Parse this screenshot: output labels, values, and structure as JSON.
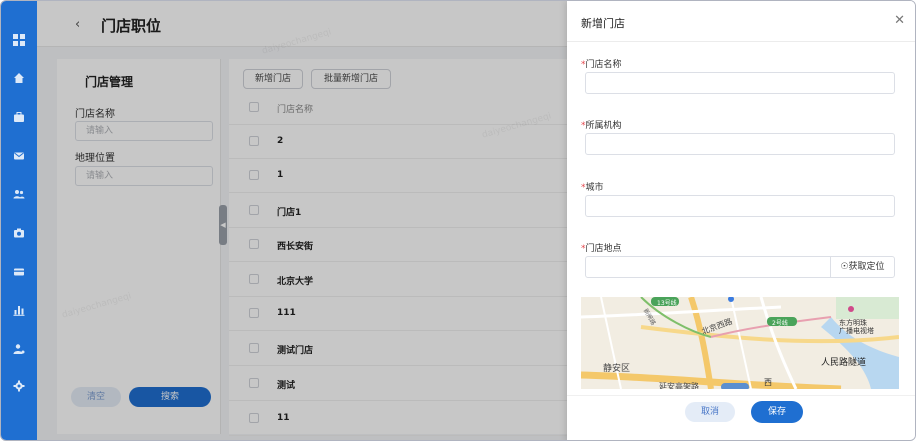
{
  "header": {
    "back_icon": "chevron-left-icon",
    "title": "门店职位"
  },
  "rail": {
    "icons": [
      "grid-icon",
      "home-icon",
      "briefcase-icon",
      "mail-icon",
      "users-icon",
      "camera-icon",
      "card-icon",
      "bar-chart-icon",
      "user-settings-icon",
      "gear-icon"
    ],
    "color": "#1f6fd1"
  },
  "filter": {
    "title": "门店管理",
    "fields": [
      {
        "label": "门店名称",
        "placeholder": "请输入"
      },
      {
        "label": "地理位置",
        "placeholder": "请输入"
      }
    ],
    "clear_label": "清空",
    "search_label": "搜索"
  },
  "toolbar": {
    "add_label": "新增门店",
    "batch_add_label": "批量新增门店"
  },
  "table": {
    "header": "门店名称",
    "rows": [
      "2",
      "1",
      "门店1",
      "西长安街",
      "北京大学",
      "111",
      "测试门店",
      "测试",
      "11"
    ]
  },
  "drawer": {
    "title": "新增门店",
    "close_icon": "close-icon",
    "fields": [
      {
        "label": "门店名称",
        "required_mark": "*"
      },
      {
        "label": "所属机构",
        "required_mark": "*"
      },
      {
        "label": "城市",
        "required_mark": "*"
      },
      {
        "label": "门店地点",
        "required_mark": "*"
      }
    ],
    "locate_label": "获取定位",
    "locate_icon": "location-pin-icon",
    "map_labels": {
      "beijing_west_road": "北京西路",
      "line2": "2号线",
      "line13": "13号线",
      "tower": "东方明珠\n广播电视塔",
      "renmin_tunnel": "人民路隧道",
      "jingan": "静安区",
      "yanan": "延安高架路",
      "west": "西",
      "xinzha": "新闸路"
    },
    "cancel_label": "取消",
    "save_label": "保存"
  },
  "watermark": "daiyeochangeqi"
}
